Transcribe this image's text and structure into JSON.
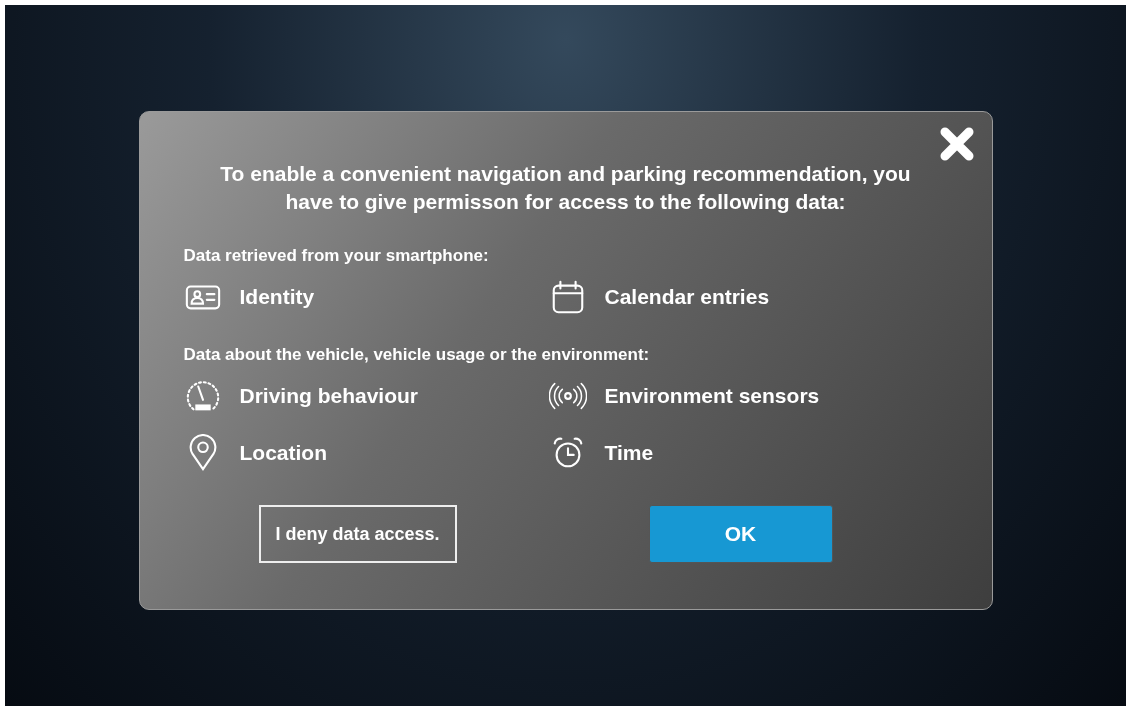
{
  "dialog": {
    "message": "To enable a convenient navigation and parking recommendation, you have to give permisson for access to the following data:",
    "sections": [
      {
        "heading": "Data retrieved from your smartphone:",
        "items": [
          {
            "kind": "identity",
            "label": "Identity"
          },
          {
            "kind": "calendar",
            "label": "Calendar entries"
          }
        ]
      },
      {
        "heading": "Data about the vehicle, vehicle usage or the environment:",
        "items": [
          {
            "kind": "speedometer",
            "label": "Driving behaviour"
          },
          {
            "kind": "sensor",
            "label": "Environment sensors"
          },
          {
            "kind": "location",
            "label": "Location"
          },
          {
            "kind": "alarm",
            "label": "Time"
          }
        ]
      }
    ],
    "buttons": [
      {
        "kind": "secondary",
        "label": "I deny data access."
      },
      {
        "kind": "primary",
        "label": "OK"
      }
    ]
  }
}
